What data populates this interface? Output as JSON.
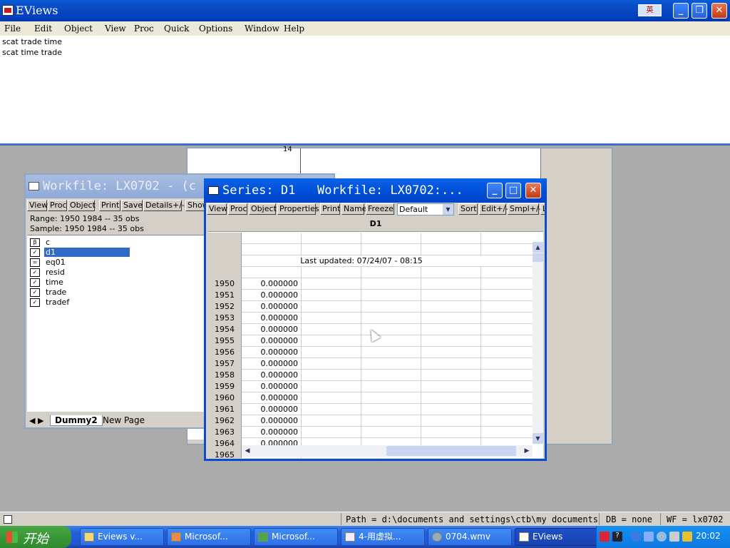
{
  "app": {
    "title": "EViews",
    "ime": "英"
  },
  "menu": [
    "File",
    "Edit",
    "Object",
    "View",
    "Proc",
    "Quick",
    "Options",
    "Window",
    "Help"
  ],
  "command_window": {
    "lines": [
      "scat trade time",
      "scat time trade"
    ]
  },
  "background_window": {
    "tick_label": "14"
  },
  "workfile_window": {
    "title": "Workfile: LX0702 - (c",
    "buttons": [
      "View",
      "Proc",
      "Object",
      "Print",
      "Save",
      "Details+/-",
      "Show"
    ],
    "range": "Range:  1950 1984  --  35 obs",
    "sample": "Sample: 1950 1984  --  35 obs",
    "objects": [
      {
        "name": "c",
        "icon": "coef-icon",
        "glyph": "β"
      },
      {
        "name": "d1",
        "icon": "series-icon",
        "selected": true
      },
      {
        "name": "eq01",
        "icon": "equation-icon",
        "glyph": "="
      },
      {
        "name": "resid",
        "icon": "series-icon"
      },
      {
        "name": "time",
        "icon": "series-icon"
      },
      {
        "name": "trade",
        "icon": "series-icon"
      },
      {
        "name": "tradef",
        "icon": "series-icon"
      }
    ],
    "tabs": [
      "Dummy2",
      "New Page"
    ]
  },
  "series_window": {
    "title": "Series: D1   Workfile: LX0702:...",
    "buttons": [
      "View",
      "Proc",
      "Object",
      "Properties",
      "Print",
      "Name",
      "Freeze"
    ],
    "dropdown": "Default",
    "buttons2": [
      "Sort",
      "Edit+/-",
      "Smpl+/-",
      "L"
    ],
    "column_header": "D1",
    "last_updated": "Last updated: 07/24/07 - 08:15",
    "rows": [
      {
        "year": "1950",
        "value": "0.000000"
      },
      {
        "year": "1951",
        "value": "0.000000"
      },
      {
        "year": "1952",
        "value": "0.000000"
      },
      {
        "year": "1953",
        "value": "0.000000"
      },
      {
        "year": "1954",
        "value": "0.000000"
      },
      {
        "year": "1955",
        "value": "0.000000"
      },
      {
        "year": "1956",
        "value": "0.000000"
      },
      {
        "year": "1957",
        "value": "0.000000"
      },
      {
        "year": "1958",
        "value": "0.000000"
      },
      {
        "year": "1959",
        "value": "0.000000"
      },
      {
        "year": "1960",
        "value": "0.000000"
      },
      {
        "year": "1961",
        "value": "0.000000"
      },
      {
        "year": "1962",
        "value": "0.000000"
      },
      {
        "year": "1963",
        "value": "0.000000"
      },
      {
        "year": "1964",
        "value": "0.000000"
      },
      {
        "year": "1965",
        "value": ""
      }
    ]
  },
  "status_bar": {
    "path": "Path = d:\\documents and settings\\ctb\\my documents",
    "db": "DB = none",
    "wf": "WF = lx0702"
  },
  "taskbar": {
    "start": "开始",
    "tasks": [
      "Eviews v...",
      "Microsof...",
      "Microsof...",
      "4-用虚拟...",
      "0704.wmv",
      "EViews"
    ],
    "clock": "20:02"
  }
}
